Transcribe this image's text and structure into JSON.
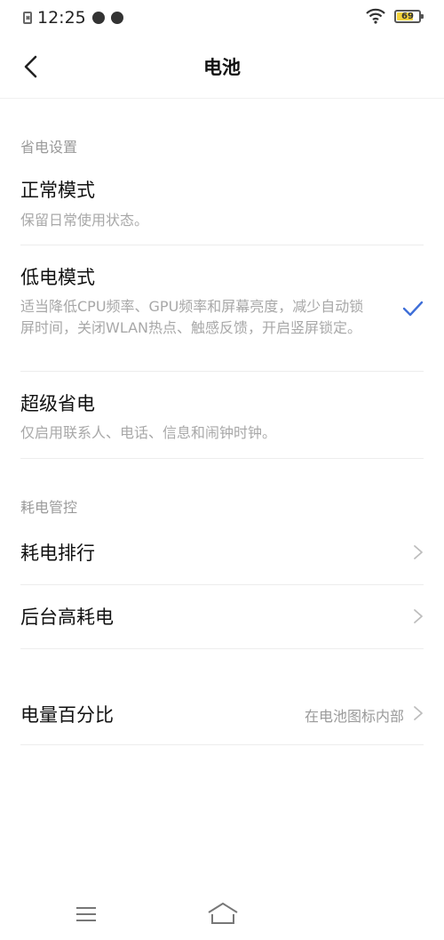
{
  "status_bar": {
    "time": "12:25",
    "battery_level": "69",
    "battery_fraction": 0.69
  },
  "header": {
    "title": "电池"
  },
  "power_saving": {
    "section_title": "省电设置",
    "modes": [
      {
        "title": "正常模式",
        "description": "保留日常使用状态。",
        "selected": false
      },
      {
        "title": "低电模式",
        "description": "适当降低CPU频率、GPU频率和屏幕亮度，减少自动锁屏时间，关闭WLAN热点、触感反馈，开启竖屏锁定。",
        "selected": true
      },
      {
        "title": "超级省电",
        "description": "仅启用联系人、电话、信息和闹钟时钟。",
        "selected": false
      }
    ]
  },
  "power_control": {
    "section_title": "耗电管控",
    "items": [
      {
        "title": "耗电排行"
      },
      {
        "title": "后台高耗电"
      }
    ]
  },
  "battery_percentage": {
    "title": "电量百分比",
    "value": "在电池图标内部"
  },
  "colors": {
    "accent": "#3f6fd8",
    "text_primary": "#111111",
    "text_secondary": "#a8a8a8",
    "divider": "#ededed"
  },
  "icons": {
    "back": "chevron-left-icon",
    "check": "check-icon",
    "chevron": "chevron-right-icon",
    "nav_menu": "menu-icon",
    "nav_home": "home-icon"
  }
}
